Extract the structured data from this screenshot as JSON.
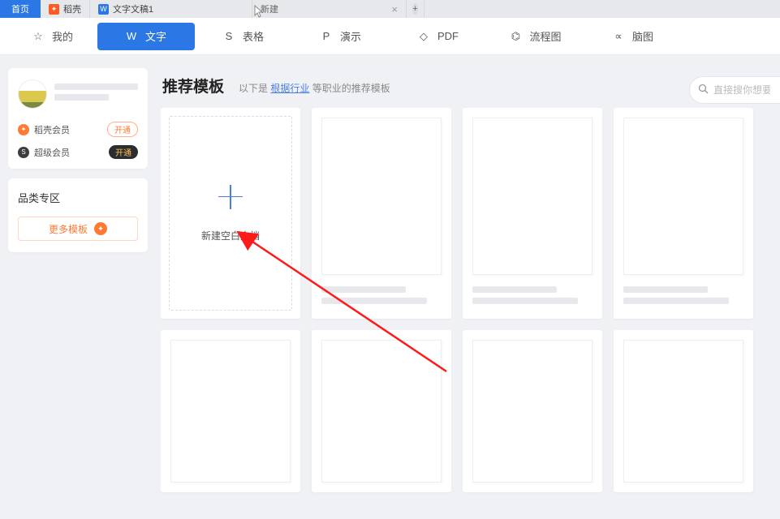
{
  "tabs": {
    "home": "首页",
    "docke": "稻壳",
    "doc1": "文字文稿1",
    "newtab": "新建"
  },
  "nav": {
    "mine": "我的",
    "text": "文字",
    "sheet": "表格",
    "present": "演示",
    "pdf": "PDF",
    "flow": "流程图",
    "mind": "脑图"
  },
  "sidebar": {
    "rice_member": "稻壳会员",
    "super_member": "超级会员",
    "open1": "开通",
    "open2": "开通",
    "cat_title": "品类专区",
    "more": "更多模板"
  },
  "content": {
    "title": "推荐模板",
    "sub_prefix": "以下是 ",
    "sub_link": "根据行业",
    "sub_suffix": " 等职业的推荐模板",
    "search_placeholder": "直接搜你想要的",
    "blank_doc": "新建空白文档"
  }
}
